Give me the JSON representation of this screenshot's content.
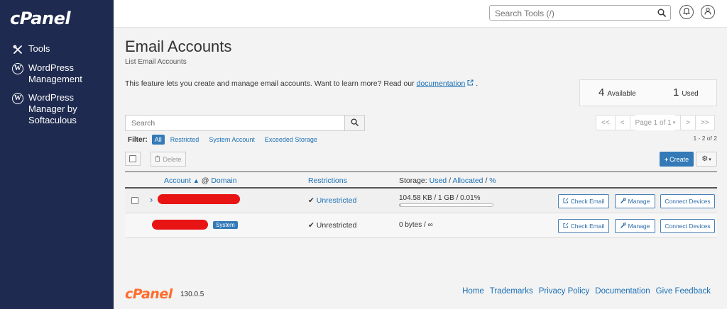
{
  "sidebar": {
    "logo": "cPanel",
    "items": [
      {
        "label": "Tools",
        "icon": "tools-icon"
      },
      {
        "label": "WordPress Management",
        "icon": "wordpress-icon"
      },
      {
        "label": "WordPress Manager by Softaculous",
        "icon": "wordpress-icon"
      }
    ]
  },
  "header": {
    "search_placeholder": "Search Tools (/)",
    "notification_icon": "bell-icon",
    "user_icon": "user-icon"
  },
  "page": {
    "title": "Email Accounts",
    "subtitle": "List Email Accounts",
    "intro_text": "This feature lets you create and manage email accounts. Want to learn more? Read our",
    "intro_link": "documentation",
    "intro_end": "."
  },
  "stats": {
    "available_count": "4",
    "available_label": "Available",
    "used_count": "1",
    "used_label": "Used"
  },
  "search": {
    "placeholder": "Search"
  },
  "pagination": {
    "first": "<<",
    "prev": "<",
    "page_label": "Page 1 of 1",
    "next": ">",
    "last": ">>",
    "count": "1 - 2 of 2"
  },
  "filter": {
    "label": "Filter:",
    "options": [
      "All",
      "Restricted",
      "System Account",
      "Exceeded Storage"
    ]
  },
  "toolbar": {
    "delete_label": "Delete",
    "create_label": "Create"
  },
  "table": {
    "headers": {
      "account": "Account",
      "at": "@",
      "domain": "Domain",
      "restrictions": "Restrictions",
      "storage_label": "Storage:",
      "used": "Used",
      "sep1": "/",
      "allocated": "Allocated",
      "sep2": "/",
      "percent": "%"
    },
    "rows": [
      {
        "restriction": "Unrestricted",
        "storage": "104.58 KB / 1 GB / 0.01%",
        "storage_fraction": 0.0001,
        "badge": ""
      },
      {
        "restriction": "Unrestricted",
        "storage": "0 bytes / ∞",
        "badge": "System"
      }
    ],
    "actions": {
      "check_email": "Check Email",
      "manage": "Manage",
      "connect": "Connect Devices"
    }
  },
  "footer": {
    "logo": "cPanel",
    "version": "130.0.5",
    "links": [
      "Home",
      "Trademarks",
      "Privacy Policy",
      "Documentation",
      "Give Feedback"
    ]
  },
  "colors": {
    "sidebar_bg": "#1e2a4f",
    "accent": "#337ab7",
    "brand_orange": "#ff6c2c",
    "redaction": "#e81414"
  }
}
